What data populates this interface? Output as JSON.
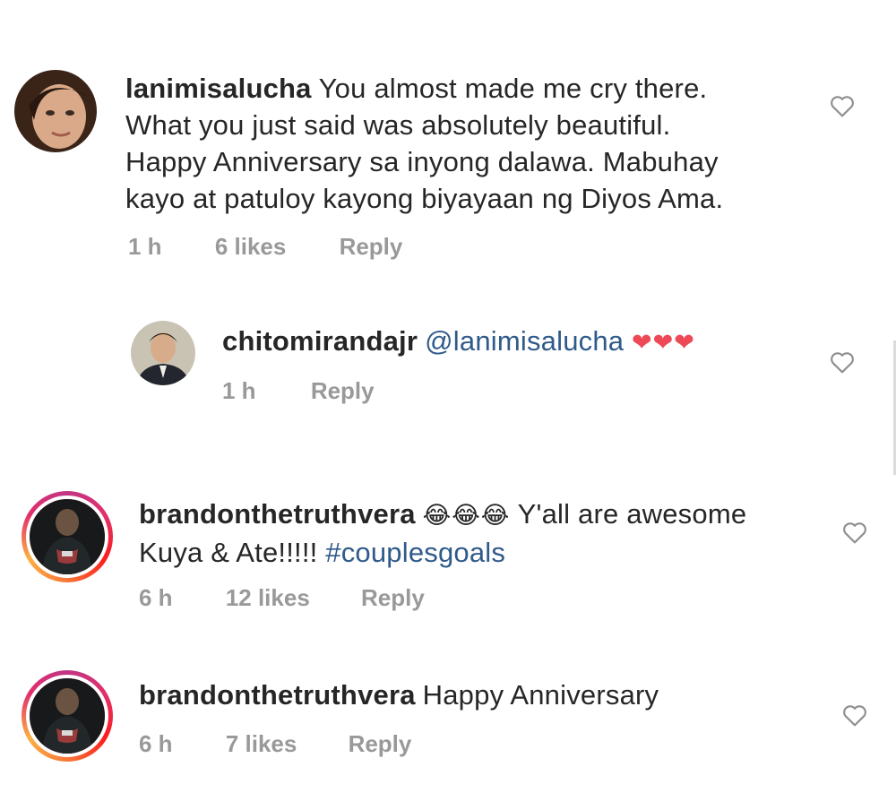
{
  "comments": [
    {
      "username": "lanimisalucha",
      "text_lines": [
        "You almost made me cry there.",
        "What you just said was absolutely beautiful.",
        "Happy Anniversary sa inyong dalawa. Mabuhay",
        "kayo at patuloy kayong biyayaan ng Diyos Ama."
      ],
      "time": "1 h",
      "likes": "6 likes",
      "reply_label": "Reply"
    },
    {
      "username": "chitomirandajr",
      "mention": "@lanimisalucha",
      "emoji": "❤❤❤",
      "time": "1 h",
      "reply_label": "Reply"
    },
    {
      "username": "brandonthetruthvera",
      "emoji": "😂😂😂",
      "text_a": "Y'all are awesome",
      "text_b": "Kuya & Ate!!!!!",
      "hashtag": "#couplesgoals",
      "time": "6 h",
      "likes": "12 likes",
      "reply_label": "Reply"
    },
    {
      "username": "brandonthetruthvera",
      "text": "Happy Anniversary",
      "time": "6 h",
      "likes": "7 likes",
      "reply_label": "Reply"
    }
  ],
  "colors": {
    "text": "#262626",
    "muted": "#999999",
    "link": "#2f5a8a",
    "heart": "#ed4956"
  },
  "icons": {
    "like": "heart-outline-icon"
  }
}
